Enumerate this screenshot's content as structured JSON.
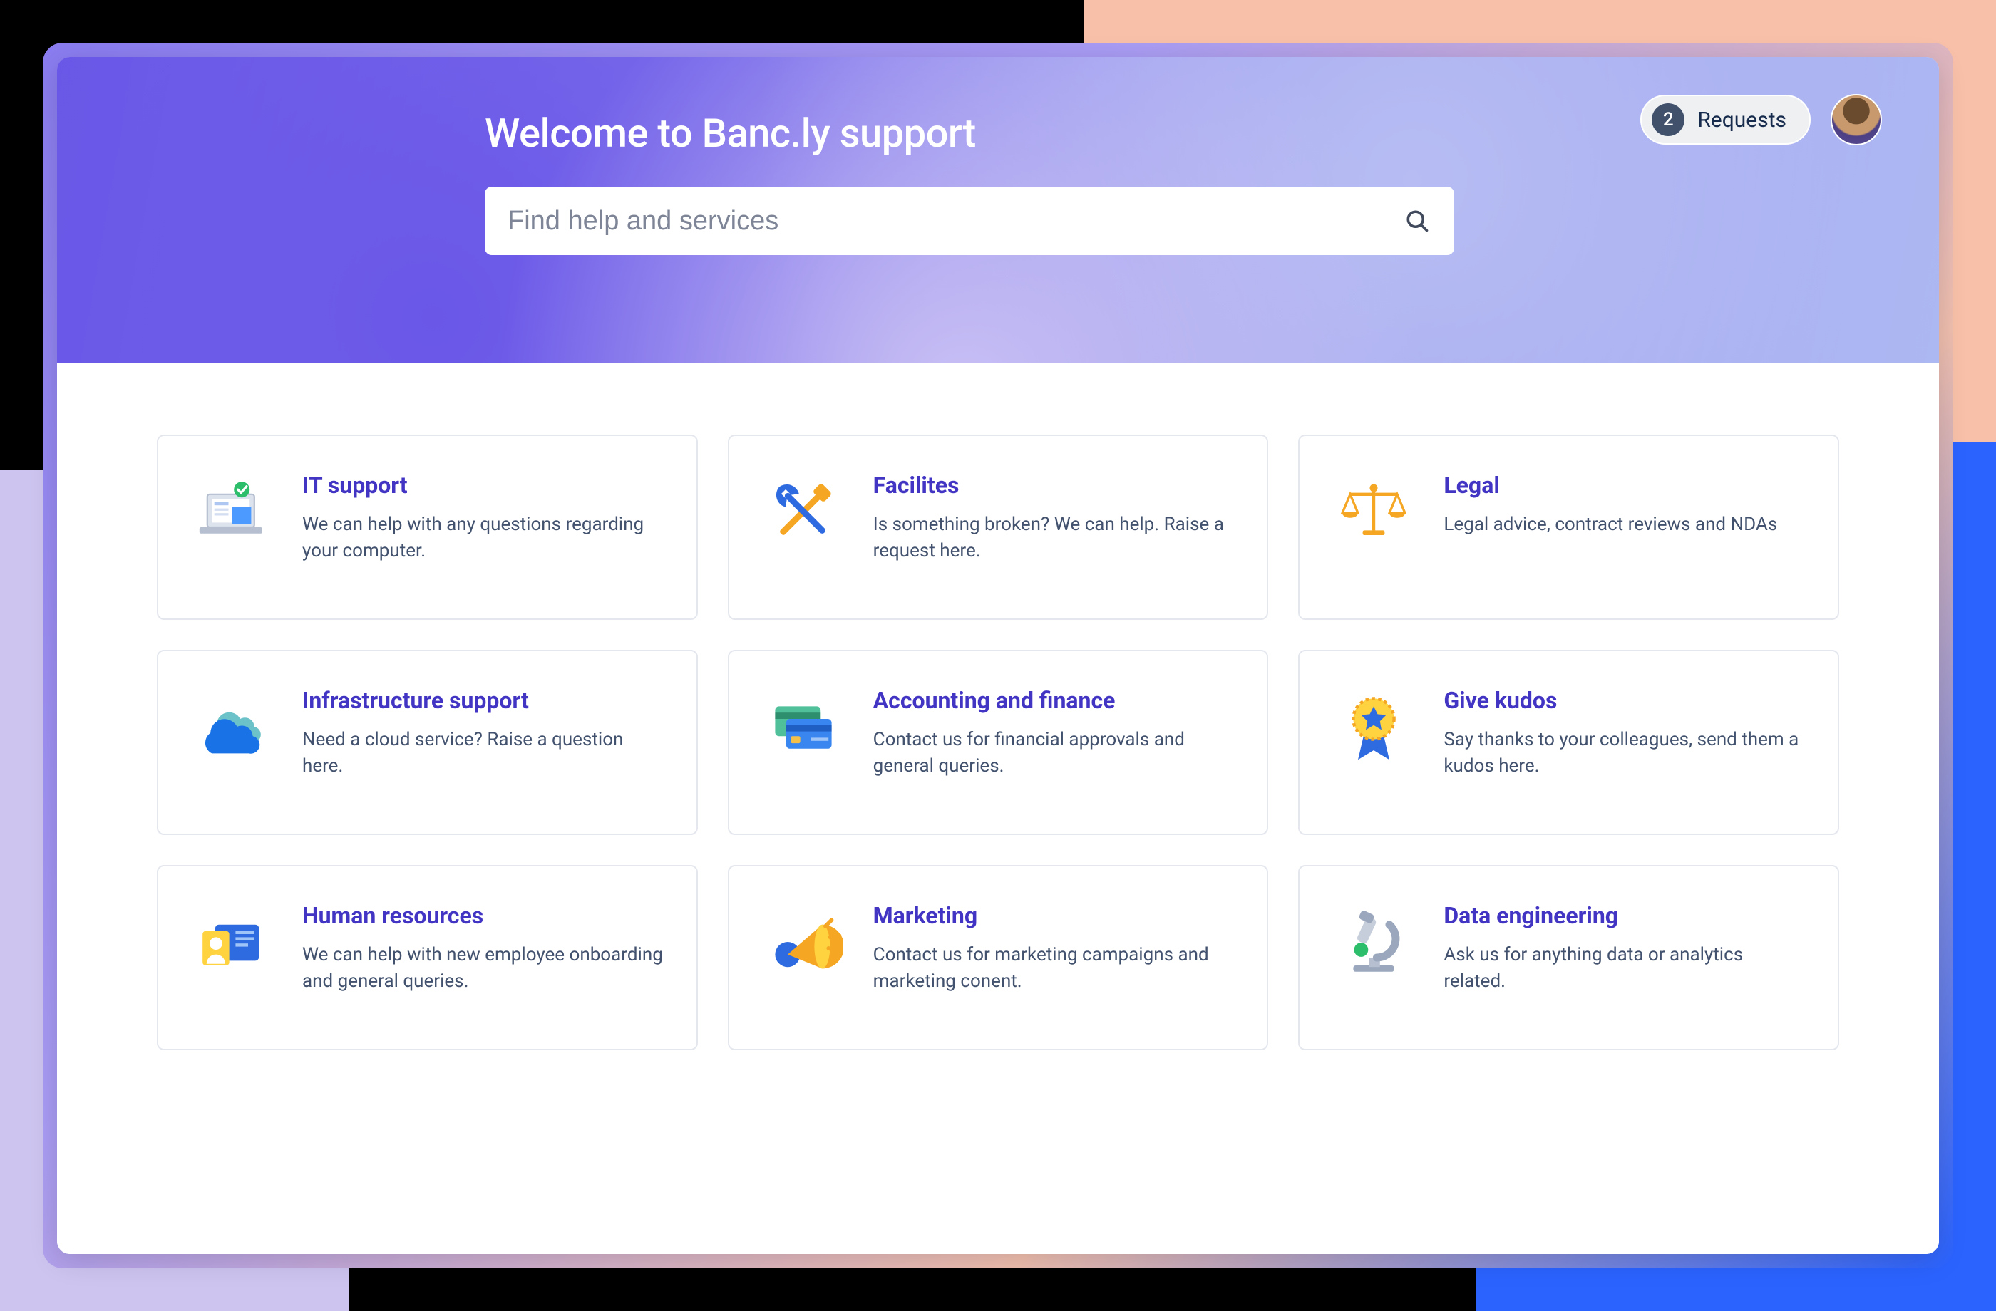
{
  "header": {
    "title": "Welcome to Banc.ly support",
    "search_placeholder": "Find help and services",
    "requests_count": "2",
    "requests_label": "Requests"
  },
  "cards": [
    {
      "icon": "computer-check-icon",
      "title": "IT support",
      "desc": "We can help with any questions regarding your computer."
    },
    {
      "icon": "tools-icon",
      "title": "Facilites",
      "desc": "Is something broken? We can help. Raise a request here."
    },
    {
      "icon": "scales-icon",
      "title": "Legal",
      "desc": "Legal advice, contract reviews and NDAs"
    },
    {
      "icon": "cloud-icon",
      "title": "Infrastructure support",
      "desc": "Need a cloud service? Raise a question here."
    },
    {
      "icon": "credit-cards-icon",
      "title": "Accounting and finance",
      "desc": "Contact us for financial approvals and general queries."
    },
    {
      "icon": "award-ribbon-icon",
      "title": "Give kudos",
      "desc": "Say thanks to your colleagues, send them a kudos here."
    },
    {
      "icon": "id-card-icon",
      "title": "Human resources",
      "desc": "We can help with new employee onboarding and general queries."
    },
    {
      "icon": "megaphone-icon",
      "title": "Marketing",
      "desc": "Contact us for marketing campaigns and marketing conent."
    },
    {
      "icon": "microscope-icon",
      "title": "Data engineering",
      "desc": "Ask us for anything data or analytics related."
    }
  ]
}
